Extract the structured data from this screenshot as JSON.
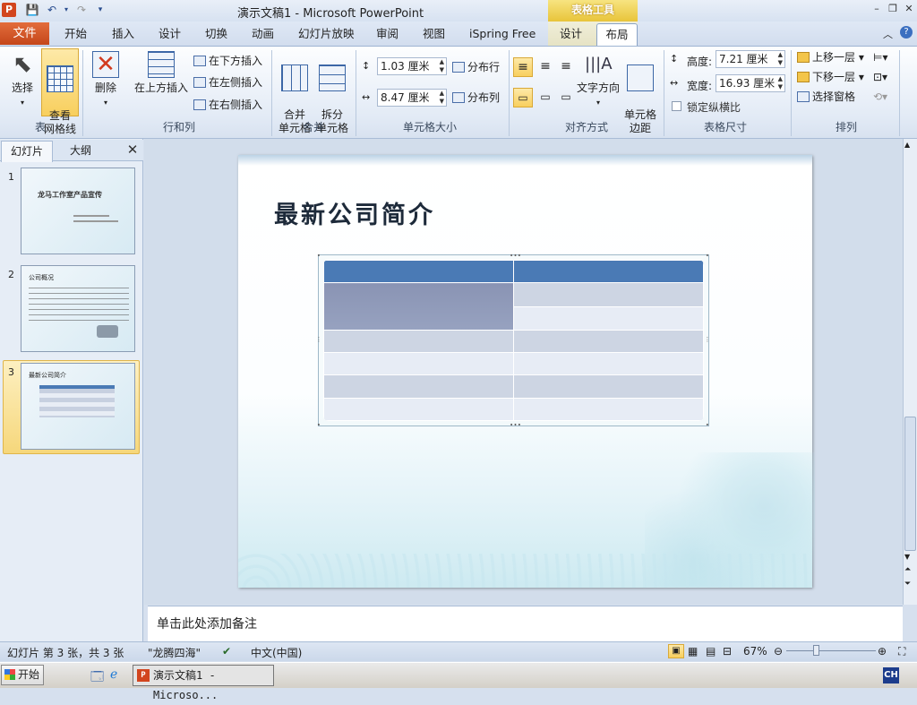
{
  "window": {
    "app_icon": "P",
    "title": "演示文稿1 - Microsoft PowerPoint",
    "table_tools": "表格工具",
    "controls": [
      "minimize-icon",
      "restore-icon",
      "close-icon"
    ]
  },
  "tabs": {
    "file": "文件",
    "items": [
      "开始",
      "插入",
      "设计",
      "切换",
      "动画",
      "幻灯片放映",
      "审阅",
      "视图",
      "iSpring Free",
      "设计"
    ],
    "active": "布局"
  },
  "ribbon": {
    "select": "选择",
    "view_gridlines": "查看\n网格线",
    "delete": "删除",
    "insert_above": "在上方插入",
    "insert_below": "在下方插入",
    "insert_left": "在左侧插入",
    "insert_right": "在右侧插入",
    "merge_cells": "合并\n单元格",
    "split_cells": "拆分\n单元格",
    "cell_height": "1.03 厘米",
    "cell_width": "8.47 厘米",
    "distribute_rows": "分布行",
    "distribute_cols": "分布列",
    "text_direction": "文字方向",
    "cell_margins": "单元格\n边距",
    "table_height_label": "高度:",
    "table_height": "7.21 厘米",
    "table_width_label": "宽度:",
    "table_width": "16.93 厘米",
    "lock_ratio": "锁定纵横比",
    "bring_forward": "上移一层",
    "send_backward": "下移一层",
    "selection_pane": "选择窗格",
    "groups": {
      "table": "表",
      "rows_cols": "行和列",
      "merge": "合并",
      "cell_size": "单元格大小",
      "alignment": "对齐方式",
      "table_size": "表格尺寸",
      "arrange": "排列"
    }
  },
  "left_pane": {
    "tab_slides": "幻灯片",
    "tab_outline": "大纲",
    "close": "✕",
    "thumbnails": [
      {
        "num": "1",
        "title": "龙马工作室产品宣传"
      },
      {
        "num": "2",
        "title": "公司概况"
      },
      {
        "num": "3",
        "title": "最新公司简介"
      }
    ]
  },
  "slide": {
    "title": "最新公司简介",
    "table_rows": 7,
    "table_cols": 2
  },
  "notes": {
    "placeholder": "单击此处添加备注"
  },
  "status": {
    "slide_info": "幻灯片 第 3 张，共 3 张",
    "theme": "\"龙腾四海\"",
    "language": "中文(中国)",
    "zoom": "67%"
  },
  "taskbar": {
    "start": "开始",
    "item": "演示文稿1 - Microso...",
    "ime": "CH"
  },
  "colors": {
    "header_blue": "#4a7ab5",
    "merged_cell": "#8a97b8",
    "row_dark": "#cdd5e3",
    "row_light": "#e7ecf5",
    "file_tab": "#d2501e",
    "table_tools": "#e8c43a"
  }
}
